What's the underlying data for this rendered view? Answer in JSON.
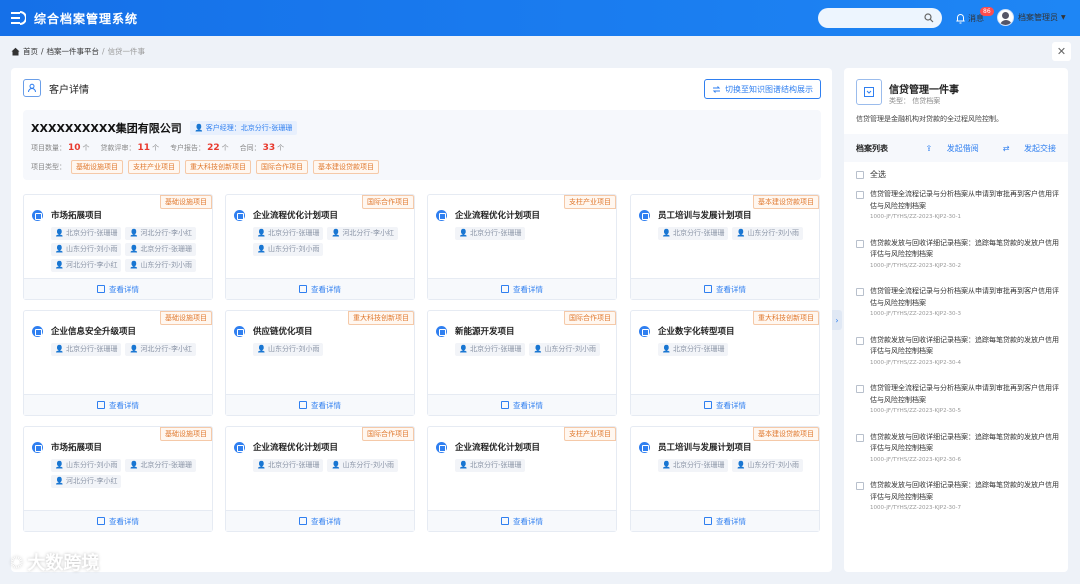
{
  "app": {
    "title": "综合档案管理系统",
    "msg_label": "消息",
    "msg_count": "86",
    "user": "档案管理员"
  },
  "breadcrumb": {
    "home": "首页",
    "sep1": "/",
    "platform": "档案一件事平台",
    "sep2": "/",
    "current": "信贷一件事"
  },
  "left": {
    "title": "客户详情",
    "switch_label": "切换至知识图谱结构展示",
    "company": {
      "name": "XXXXXXXXXX集团有限公司",
      "manager": "客户经理：北京分行-张珊珊",
      "stats": [
        {
          "label": "项目数量：",
          "value": "10",
          "unit": "个"
        },
        {
          "label": "贷款评审：",
          "value": "11",
          "unit": "个"
        },
        {
          "label": "专户报告：",
          "value": "22",
          "unit": "个"
        },
        {
          "label": "合同：",
          "value": "33",
          "unit": "个"
        }
      ],
      "type_label": "项目类型：",
      "types": [
        "基础设施项目",
        "支柱产业项目",
        "重大科技创新项目",
        "国际合作项目",
        "基本建设贷款项目"
      ]
    },
    "view_label": "查看详情",
    "cards": [
      {
        "title": "市场拓展项目",
        "tag": "基础设施项目",
        "persons": [
          "北京分行-张珊珊",
          "河北分行-李小红",
          "山东分行-刘小雨",
          "北京分行-张珊珊",
          "河北分行-李小红",
          "山东分行-刘小雨"
        ]
      },
      {
        "title": "企业流程优化计划项目",
        "tag": "国际合作项目",
        "persons": [
          "北京分行-张珊珊",
          "河北分行-李小红",
          "山东分行-刘小雨"
        ]
      },
      {
        "title": "企业流程优化计划项目",
        "tag": "支柱产业项目",
        "persons": [
          "北京分行-张珊珊"
        ]
      },
      {
        "title": "员工培训与发展计划项目",
        "tag": "基本建设贷款项目",
        "persons": [
          "北京分行-张珊珊",
          "山东分行-刘小雨"
        ]
      },
      {
        "title": "企业信息安全升级项目",
        "tag": "基础设施项目",
        "persons": [
          "北京分行-张珊珊",
          "河北分行-李小红"
        ]
      },
      {
        "title": "供应链优化项目",
        "tag": "重大科技创新项目",
        "persons": [
          "山东分行-刘小雨"
        ]
      },
      {
        "title": "新能源开发项目",
        "tag": "国际合作项目",
        "persons": [
          "北京分行-张珊珊",
          "山东分行-刘小雨"
        ]
      },
      {
        "title": "企业数字化转型项目",
        "tag": "重大科技创新项目",
        "persons": [
          "北京分行-张珊珊"
        ]
      },
      {
        "title": "市场拓展项目",
        "tag": "基础设施项目",
        "persons": [
          "山东分行-刘小雨",
          "北京分行-张珊珊",
          "河北分行-李小红"
        ]
      },
      {
        "title": "企业流程优化计划项目",
        "tag": "国际合作项目",
        "persons": [
          "北京分行-张珊珊",
          "山东分行-刘小雨"
        ]
      },
      {
        "title": "企业流程优化计划项目",
        "tag": "支柱产业项目",
        "persons": [
          "北京分行-张珊珊"
        ]
      },
      {
        "title": "员工培训与发展计划项目",
        "tag": "基本建设贷款项目",
        "persons": [
          "北京分行-张珊珊",
          "山东分行-刘小雨"
        ]
      }
    ]
  },
  "right": {
    "title": "信贷管理一件事",
    "type": "类型：  信贷档案",
    "desc": "信贷管理是金融机构对贷款的全过程风险控制。",
    "list_title": "档案列表",
    "action1": "发起借阅",
    "action2": "发起交接",
    "select_all": "全选",
    "items": [
      {
        "text": "信贷管理全流程记录与分析档案从申请到审批再到客户信用评估与风险控制档案",
        "code": "1000-JF/TYHS/ZZ-2023-KJP2-30-1"
      },
      {
        "text": "信贷款发放与回收详细记录档案：追踪每笔贷款的发放户信用评估与风险控制档案",
        "code": "1000-JF/TYHS/ZZ-2023-KJP2-30-2"
      },
      {
        "text": "信贷管理全流程记录与分析档案从申请到审批再到客户信用评估与风险控制档案",
        "code": "1000-JF/TYHS/ZZ-2023-KJP2-30-3"
      },
      {
        "text": "信贷款发放与回收详细记录档案：追踪每笔贷款的发放户信用评估与风险控制档案",
        "code": "1000-JF/TYHS/ZZ-2023-KJP2-30-4"
      },
      {
        "text": "信贷管理全流程记录与分析档案从申请到审批再到客户信用评估与风险控制档案",
        "code": "1000-JF/TYHS/ZZ-2023-KJP2-30-5"
      },
      {
        "text": "信贷款发放与回收详细记录档案：追踪每笔贷款的发放户信用评估与风险控制档案",
        "code": "1000-JF/TYHS/ZZ-2023-KJP2-30-6"
      },
      {
        "text": "信贷款发放与回收详细记录档案：追踪每笔贷款的发放户信用评估与风险控制档案",
        "code": "1000-JF/TYHS/ZZ-2023-KJP2-30-7"
      }
    ]
  },
  "watermark": "大数跨境"
}
